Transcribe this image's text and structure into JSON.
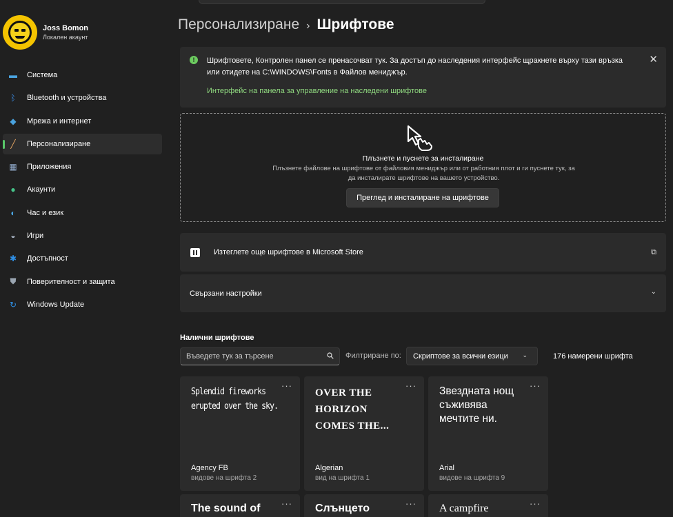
{
  "profile": {
    "name": "Joss Bomon",
    "account_type": "Локален акаунт"
  },
  "nav": [
    {
      "label": "Система",
      "icon": "monitor-icon",
      "color": "#4aa3df"
    },
    {
      "label": "Bluetooth и устройства",
      "icon": "bluetooth-icon",
      "color": "#3b8fe8"
    },
    {
      "label": "Мрежа и интернет",
      "icon": "wifi-icon",
      "color": "#4aa3df"
    },
    {
      "label": "Персонализиране",
      "icon": "brush-icon",
      "color": "#e6a663",
      "active": true
    },
    {
      "label": "Приложения",
      "icon": "apps-icon",
      "color": "#8fa8c8"
    },
    {
      "label": "Акаунти",
      "icon": "person-icon",
      "color": "#46c389"
    },
    {
      "label": "Час и език",
      "icon": "globe-clock-icon",
      "color": "#4aa3df"
    },
    {
      "label": "Игри",
      "icon": "gamepad-icon",
      "color": "#a8b4c4"
    },
    {
      "label": "Достъпност",
      "icon": "accessibility-icon",
      "color": "#2f8fe5"
    },
    {
      "label": "Поверителност и защита",
      "icon": "shield-icon",
      "color": "#9aa5b1"
    },
    {
      "label": "Windows Update",
      "icon": "update-icon",
      "color": "#2f8fe5"
    }
  ],
  "breadcrumb": {
    "parent": "Персонализиране",
    "separator": "›",
    "current": "Шрифтове"
  },
  "infobar": {
    "text": "Шрифтовете, Контролен панел се пренасочват тук. За достъп до наследения интерфейс щракнете върху тази връзка или отидете на C:\\WINDOWS\\Fonts в Файлов мениджър.",
    "link": "Интерфейс на панела за управление на наследени шрифтове",
    "icon": "!",
    "close": "✕"
  },
  "dropzone": {
    "title": "Плъзнете и пуснете за инсталиране",
    "description": "Плъзнете файлове на шрифтове от файловия мениджър или от работния плот и ги пуснете тук, за да инсталирате шрифтове на вашето устройство.",
    "button": "Преглед и инсталиране на шрифтове"
  },
  "store_link": {
    "label": "Изтеглете още шрифтове в Microsoft Store",
    "ext": "⧉"
  },
  "related": {
    "label": "Свързани настройки",
    "chevron": "⌄"
  },
  "available": {
    "heading": "Налични шрифтове",
    "search_placeholder": "Въведете тук за търсене",
    "filter_label": "Филтриране по:",
    "filter_value": "Скриптове за всички езици",
    "count": "176 намерени шрифта"
  },
  "fonts": [
    {
      "sample": "Splendid fireworks erupted over the sky.",
      "name": "Agency FB",
      "variants": "видове на шрифта 2",
      "style": "s-agency"
    },
    {
      "sample": "Over the horizon comes the...",
      "name": "Algerian",
      "variants": "вид на шрифта 1",
      "style": "s-algerian"
    },
    {
      "sample": "Звездната нощ съживява мечтите ни.",
      "name": "Arial",
      "variants": "видове на шрифта 9",
      "style": "s-arial"
    },
    {
      "sample": "The sound of",
      "name": "",
      "variants": "",
      "style": "s-bold"
    },
    {
      "sample": "Слънцето",
      "name": "",
      "variants": "",
      "style": "s-bold"
    },
    {
      "sample": "A campfire",
      "name": "",
      "variants": "",
      "style": "s-serif"
    }
  ],
  "more_icon": "···"
}
